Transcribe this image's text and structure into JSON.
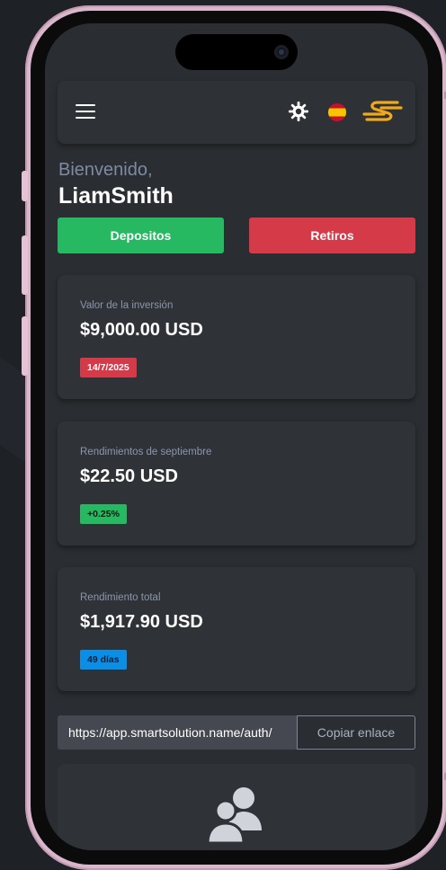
{
  "header": {
    "menu_icon": "hamburger-menu-icon",
    "settings_icon": "gear-icon",
    "language_icon": "spain-flag-icon",
    "brand_icon": "smartsolution-logo-icon",
    "brand_color": "#f0a81c"
  },
  "welcome": {
    "greeting": "Bienvenido,",
    "username": "LiamSmith"
  },
  "actions": {
    "deposit_label": "Depositos",
    "withdraw_label": "Retiros",
    "deposit_color": "#27b862",
    "withdraw_color": "#d43a48"
  },
  "cards": [
    {
      "label": "Valor de la inversión",
      "value": "$9,000.00 USD",
      "badge": "14/7/2025",
      "badge_color": "#d43a48"
    },
    {
      "label": "Rendimientos de septiembre",
      "value": "$22.50 USD",
      "badge": "+0.25%",
      "badge_color": "#27b862"
    },
    {
      "label": "Rendimiento total",
      "value": "$1,917.90 USD",
      "badge": "49 días",
      "badge_color": "#0b8ee6"
    }
  ],
  "referral": {
    "link": "https://app.smartsolution.name/auth/",
    "copy_label": "Copiar enlace"
  },
  "referrals_icon": "users-icon"
}
